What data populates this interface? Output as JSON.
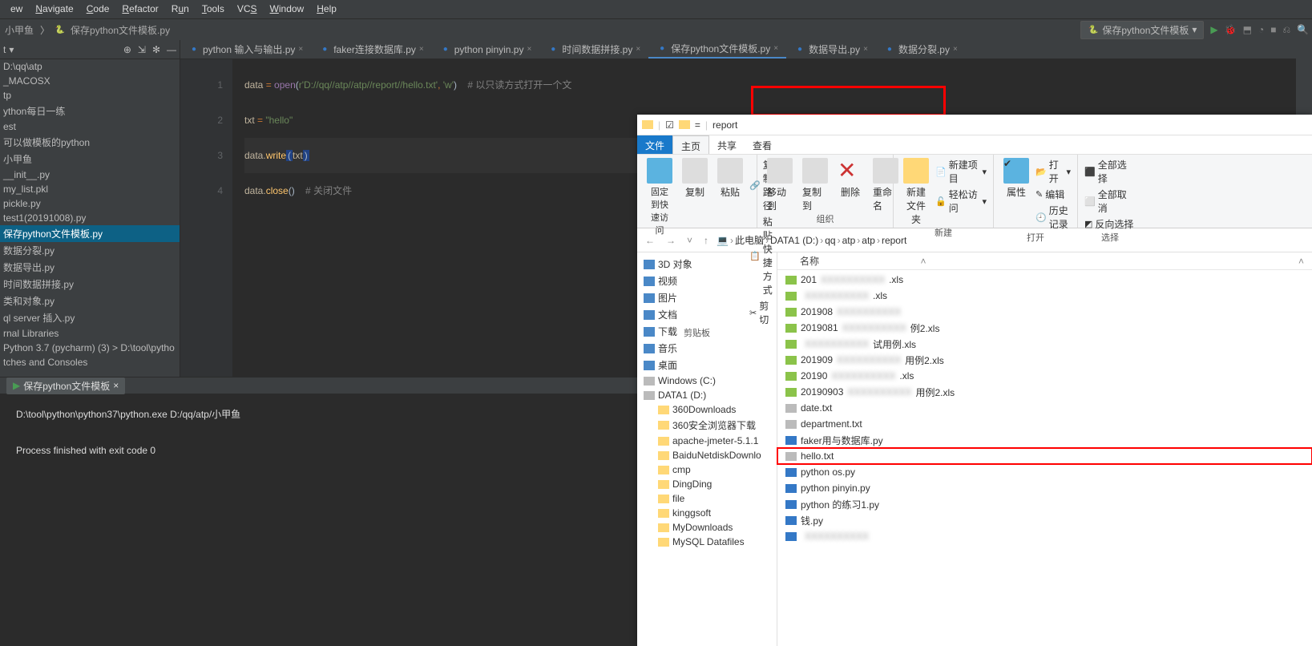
{
  "menu": [
    "ew",
    "Navigate",
    "Code",
    "Refactor",
    "Run",
    "Tools",
    "VCS",
    "Window",
    "Help"
  ],
  "crumb": {
    "left": [
      "小甲鱼",
      "保存python文件模板.py"
    ],
    "run_config": "保存python文件模板"
  },
  "side": {
    "top": "t",
    "tree": [
      " D:\\qq\\atp",
      " _MACOSX",
      " tp",
      " ython每日一练",
      " est",
      " 可以做模板的python",
      " 小甲鱼",
      "  __init__.py",
      "  my_list.pkl",
      "  pickle.py",
      "  test1(20191008).py",
      "  保存python文件模板.py",
      "  数据分裂.py",
      "  数据导出.py",
      "  时间数据拼接.py",
      "  类和对象.py",
      " ql server 插入.py",
      " rnal Libraries",
      "  Python 3.7 (pycharm) (3) >  D:\\tool\\pytho",
      " tches and Consoles"
    ],
    "sel": 11
  },
  "tabs": [
    {
      "l": "python 输入与输出.py"
    },
    {
      "l": "faker连接数据库.py"
    },
    {
      "l": "python pinyin.py"
    },
    {
      "l": "时间数据拼接.py"
    },
    {
      "l": "保存python文件模板.py",
      "cur": true
    },
    {
      "l": "数据导出.py"
    },
    {
      "l": "数据分裂.py"
    }
  ],
  "code": {
    "line1": {
      "a": "data ",
      "b": "= ",
      "c": "open",
      "d": "(",
      "e": "r'D://qq//atp//atp//report//hello.txt'",
      "f": ", ",
      "g": "'w'",
      "h": ")    ",
      "i": "# 以只读方式打开一个文"
    },
    "line2": {
      "a": "txt ",
      "b": "= ",
      "c": "\"hello\""
    },
    "line3": {
      "a": "data.",
      "b": "write",
      "c": "(",
      "d": "txt",
      "e": ")"
    },
    "line4": {
      "a": "data.",
      "b": "close",
      "c": "()",
      "d": "    # 关闭文件"
    }
  },
  "console": {
    "tab": "保存python文件模板",
    "line1": "D:\\tool\\python\\python37\\python.exe D:/qq/atp/小甲鱼",
    "line2": "Process finished with exit code 0"
  },
  "explorer": {
    "title": "report",
    "menu": [
      "文件",
      "主页",
      "共享",
      "查看"
    ],
    "ribbon": {
      "s1": {
        "b1": "固定到快\n速访问",
        "b2": "复制",
        "b3": "粘贴",
        "o1": "剪切",
        "o2": "复制路径",
        "o3": "粘贴快捷方式",
        "t": "剪贴板"
      },
      "s2": {
        "b1": "移动到",
        "b2": "复制到",
        "b3": "删除",
        "b4": "重命名",
        "t": "组织"
      },
      "s3": {
        "b1": "新建\n文件夹",
        "o1": "新建项目",
        "o2": "轻松访问",
        "t": "新建"
      },
      "s4": {
        "b1": "属性",
        "o1": "打开",
        "o2": "编辑",
        "o3": "历史记录",
        "t": "打开"
      },
      "s5": {
        "o1": "全部选择",
        "o2": "全部取消",
        "o3": "反向选择",
        "t": "选择"
      }
    },
    "bc": [
      "此电脑",
      "DATA1 (D:)",
      "qq",
      "atp",
      "atp",
      "report"
    ],
    "nav": [
      {
        "t": "3D 对象",
        "i": "3d"
      },
      {
        "t": "视频",
        "i": "v"
      },
      {
        "t": "图片",
        "i": "p"
      },
      {
        "t": "文档",
        "i": "d"
      },
      {
        "t": "下载",
        "i": "dl"
      },
      {
        "t": "音乐",
        "i": "m"
      },
      {
        "t": "桌面",
        "i": "dk"
      },
      {
        "t": "Windows (C:)",
        "i": "dr"
      },
      {
        "t": "DATA1 (D:)",
        "i": "dr"
      },
      {
        "t": "360Downloads",
        "i": "f",
        "ind": 1
      },
      {
        "t": "360安全浏览器下载",
        "i": "f",
        "ind": 1
      },
      {
        "t": "apache-jmeter-5.1.1",
        "i": "f",
        "ind": 1
      },
      {
        "t": "BaiduNetdiskDownlo",
        "i": "f",
        "ind": 1
      },
      {
        "t": "cmp",
        "i": "f",
        "ind": 1
      },
      {
        "t": "DingDing",
        "i": "f",
        "ind": 1
      },
      {
        "t": "file",
        "i": "f",
        "ind": 1
      },
      {
        "t": "kinggsoft",
        "i": "f",
        "ind": 1
      },
      {
        "t": "MyDownloads",
        "i": "f",
        "ind": 1
      },
      {
        "t": "MySQL Datafiles",
        "i": "f",
        "ind": 1
      }
    ],
    "hdr": "名称",
    "files": [
      {
        "t": "201",
        "i": "x",
        "b": 1,
        "s": ".xls"
      },
      {
        "t": "",
        "i": "x",
        "b": 1,
        "s": ".xls"
      },
      {
        "t": "201908",
        "i": "x",
        "b": 1
      },
      {
        "t": "2019081",
        "i": "x",
        "b": 1,
        "s": "例2.xls"
      },
      {
        "t": "",
        "i": "x",
        "b": 1,
        "s": "试用例.xls"
      },
      {
        "t": "201909",
        "i": "x",
        "b": 1,
        "s": "用例2.xls"
      },
      {
        "t": "20190",
        "i": "x",
        "b": 1,
        "s": ".xls"
      },
      {
        "t": "20190903",
        "i": "x",
        "b": 1,
        "s": "用例2.xls"
      },
      {
        "t": "date.txt",
        "i": "t"
      },
      {
        "t": "department.txt",
        "i": "t"
      },
      {
        "t": "faker用与数据库.py",
        "i": "py"
      },
      {
        "t": "hello.txt",
        "i": "t",
        "red": 1
      },
      {
        "t": "python os.py",
        "i": "py"
      },
      {
        "t": "python pinyin.py",
        "i": "py"
      },
      {
        "t": "python 的练习1.py",
        "i": "py"
      },
      {
        "t": "钱.py",
        "i": "py"
      },
      {
        "t": "",
        "i": "py",
        "b": 1
      }
    ]
  }
}
